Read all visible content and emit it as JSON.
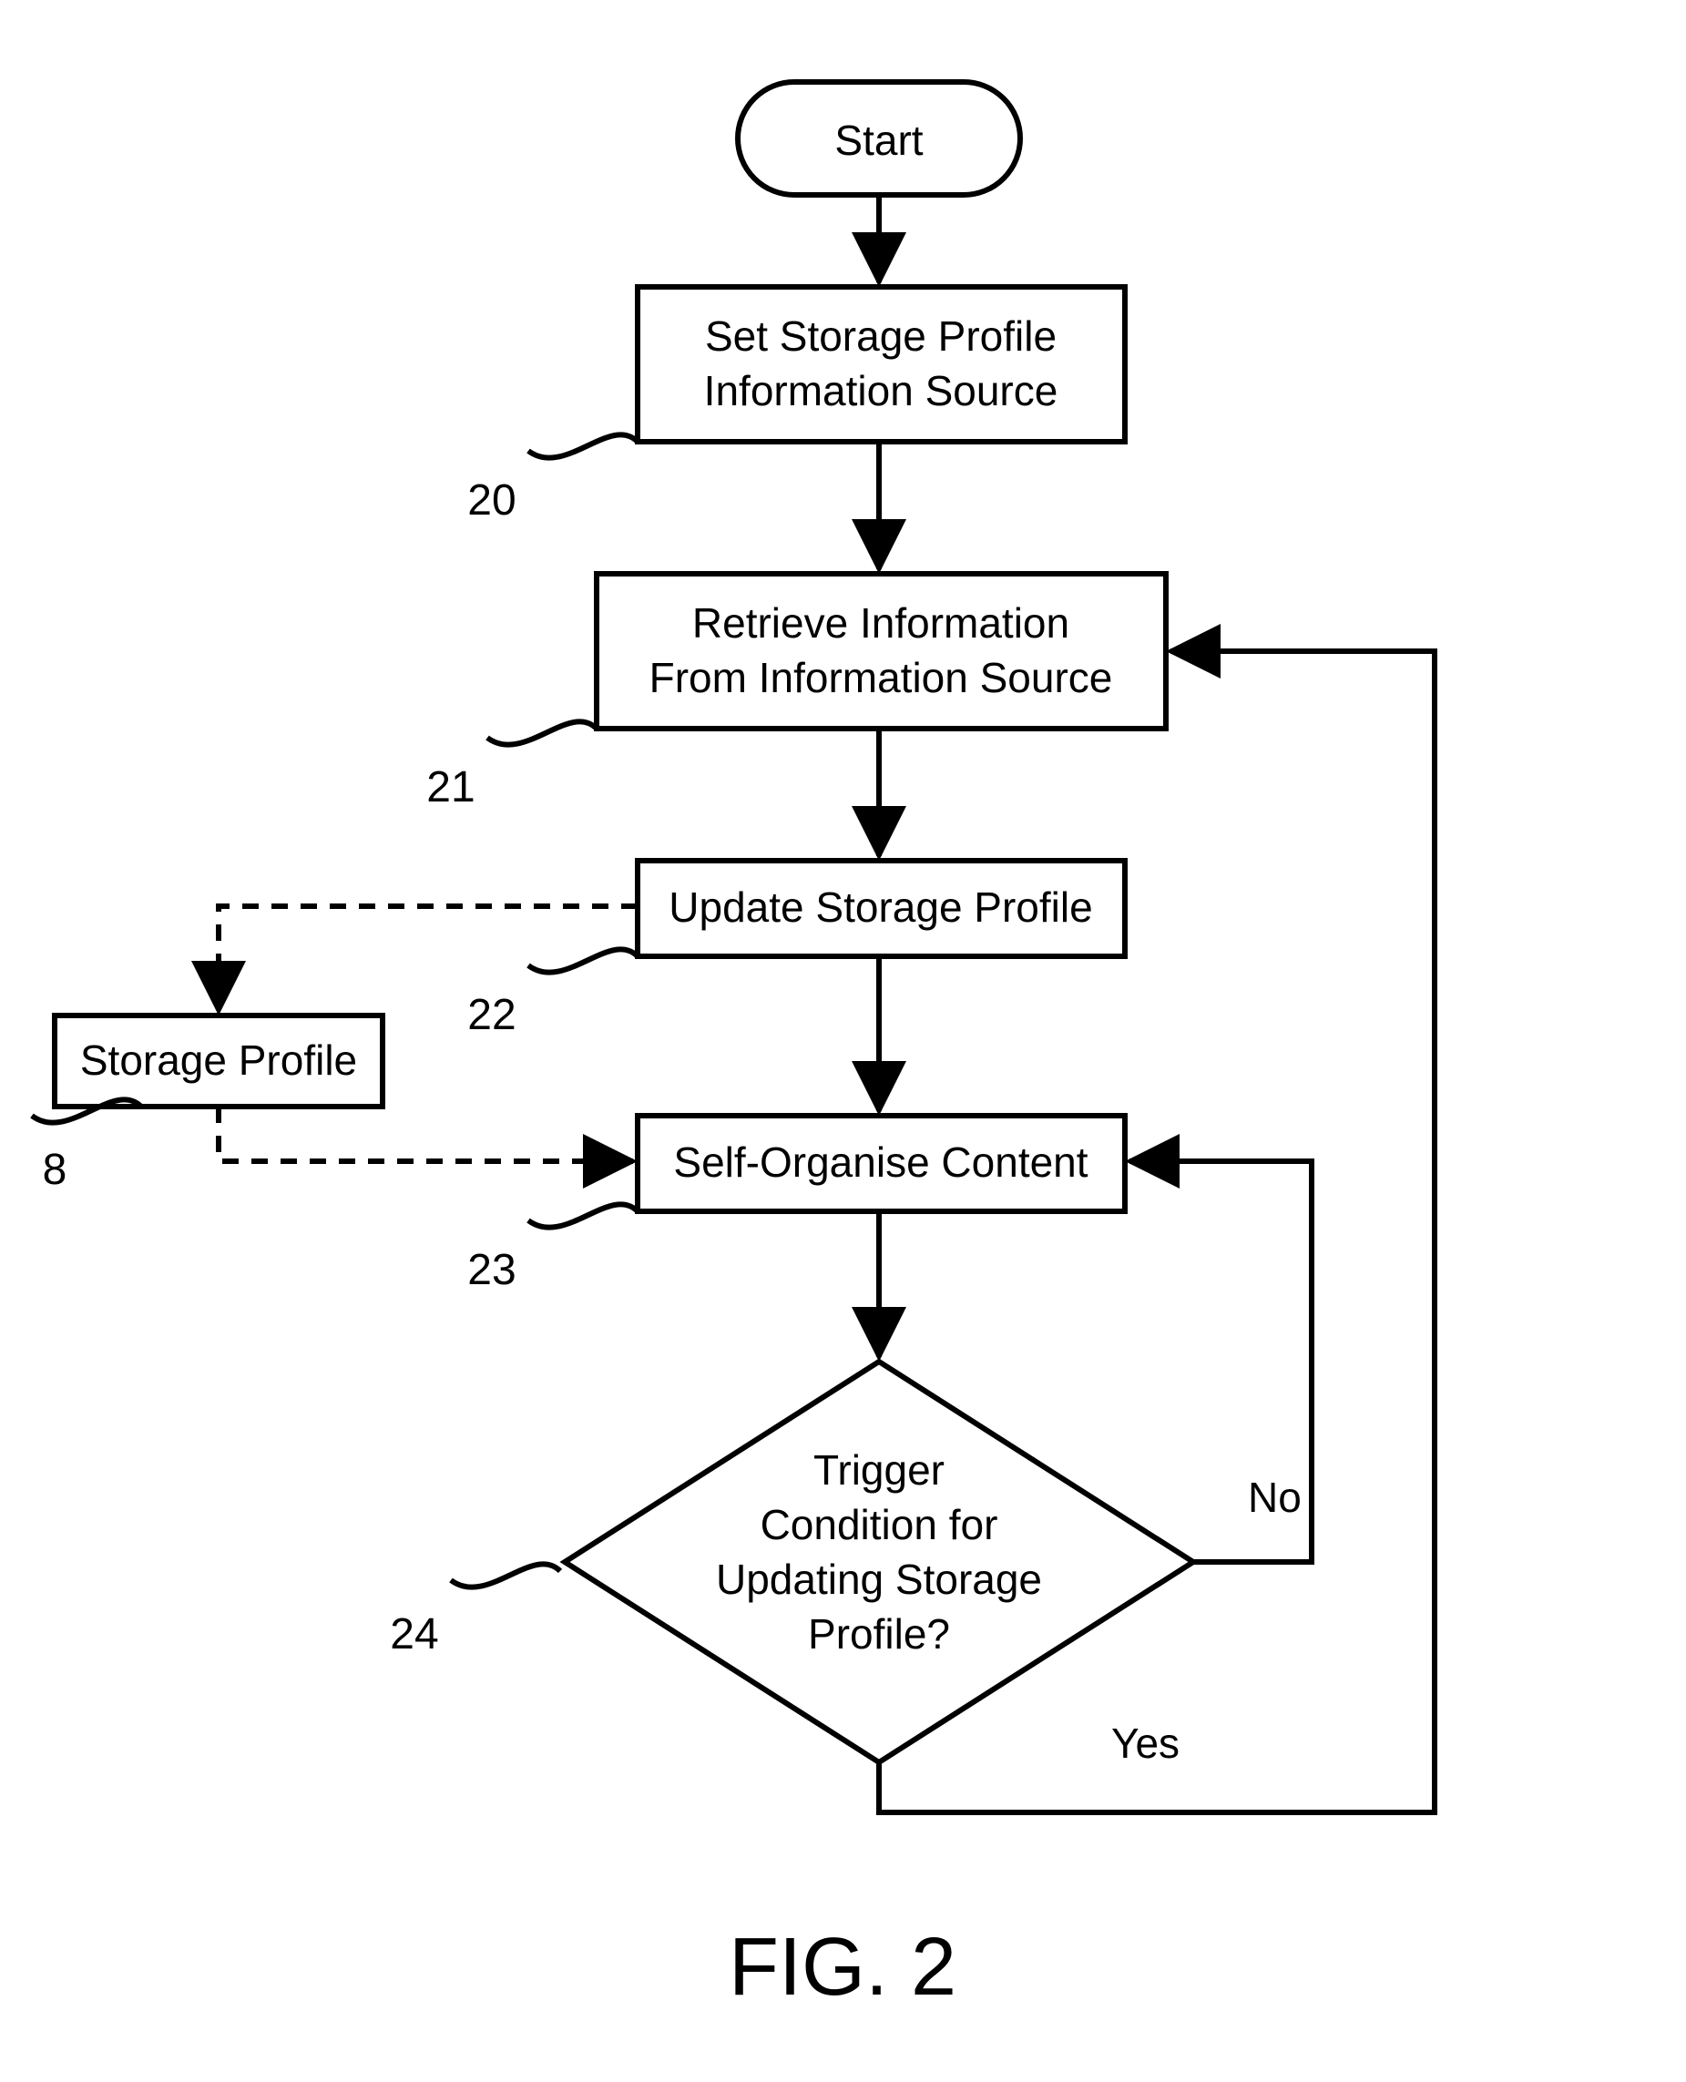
{
  "figure_label": "FIG. 2",
  "nodes": {
    "start": {
      "label": "Start",
      "ref": null
    },
    "n20": {
      "line1": "Set Storage Profile",
      "line2": "Information Source",
      "ref": "20"
    },
    "n21": {
      "line1": "Retrieve Information",
      "line2": "From Information Source",
      "ref": "21"
    },
    "n22": {
      "line1": "Update Storage Profile",
      "ref": "22"
    },
    "n23": {
      "line1": "Self-Organise Content",
      "ref": "23"
    },
    "n24": {
      "line1": "Trigger",
      "line2": "Condition for",
      "line3": "Updating Storage",
      "line4": "Profile?",
      "ref": "24"
    },
    "sp": {
      "line1": "Storage Profile",
      "ref": "8"
    }
  },
  "edges": {
    "no": "No",
    "yes": "Yes"
  }
}
